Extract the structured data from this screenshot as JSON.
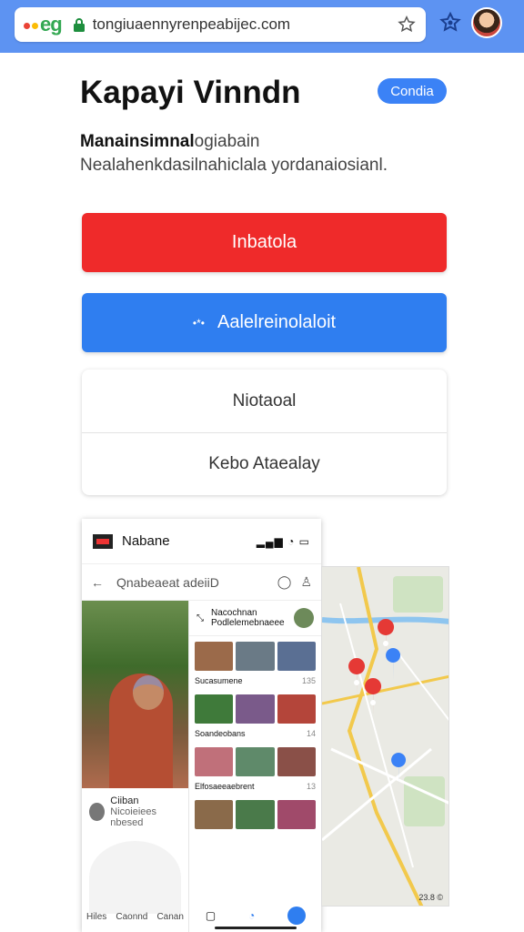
{
  "browser": {
    "logo": "eg",
    "url": "tongiuaennyr​enpeabijec.com"
  },
  "page": {
    "title": "Kapayi Vinndn",
    "pill_label": "Condia",
    "description_bold": "Manainsimnal",
    "description_rest": "ogiabain Nealahenkdasilnahiclala yordanaiosianl."
  },
  "buttons": {
    "primary_red": "Inbatola",
    "primary_blue": "Aalelreinolaloit",
    "list_items": [
      "Niotaoal",
      "Kebo Ataealay"
    ]
  },
  "phone": {
    "app_name": "Nabane",
    "signal": "▂▄▆ ◔ ▭",
    "search_query": "Qnabeaeat adeiiD",
    "user_name": "Ciiban",
    "user_sub": "Nicoieiees nbesed",
    "left_nav": [
      "Hiles",
      "Caonnd",
      "Canan"
    ],
    "feed_header": "Nacochnan\nPodlelemebnaeee",
    "feed_rows": [
      {
        "label": "Sucasumene",
        "count": "135"
      },
      {
        "label": "Soandeobans",
        "count": "14"
      },
      {
        "label": "Elfosaeeaebrent",
        "count": "13"
      }
    ],
    "map_credit": "23.8 ©"
  },
  "colors": {
    "toolbar": "#5d93f2",
    "red": "#ef2a2a",
    "blue": "#2f7ef0"
  }
}
